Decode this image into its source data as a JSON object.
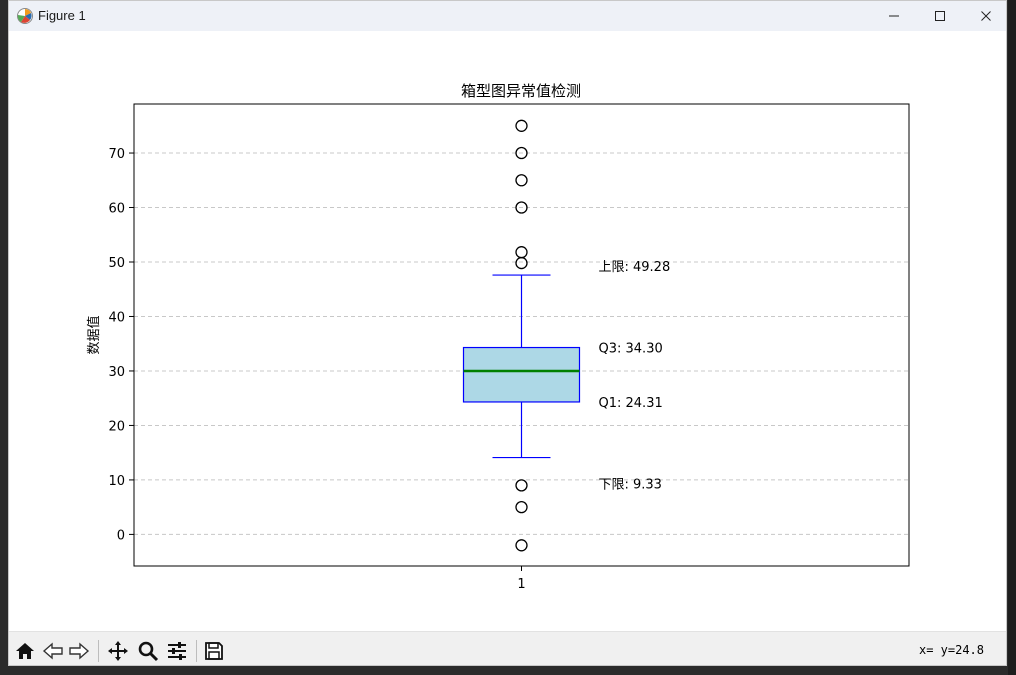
{
  "window": {
    "title": "Figure 1"
  },
  "toolbar": {
    "tools": [
      "home-icon",
      "back-arrow-icon",
      "forward-arrow-icon",
      "pan-icon",
      "zoom-icon",
      "configure-subplots-icon",
      "save-icon"
    ],
    "coords": "x= y=24.8"
  },
  "chart_data": {
    "type": "box",
    "title": "箱型图异常值检测",
    "xlabel": "",
    "ylabel": "数据值",
    "ylim": [
      -5.8,
      79
    ],
    "yticks": [
      0,
      10,
      20,
      30,
      40,
      50,
      60,
      70
    ],
    "categories": [
      "1"
    ],
    "grid": "y-dashed",
    "box": {
      "q1": 24.31,
      "median": 30.0,
      "q3": 34.3,
      "whisker_low": 14.1,
      "whisker_high": 47.6
    },
    "outliers": [
      75,
      70,
      65,
      60,
      51.8,
      49.8,
      9,
      5,
      -2
    ],
    "annotations": [
      {
        "text": "上限: 49.28",
        "y": 49.28
      },
      {
        "text": "Q3: 34.30",
        "y": 34.3
      },
      {
        "text": "Q1: 24.31",
        "y": 24.31
      },
      {
        "text": "下限: 9.33",
        "y": 9.33
      }
    ],
    "colors": {
      "box_fill": "#add8e6",
      "box_edge": "#0000ff",
      "median": "#008000",
      "grid": "#c8c8c8"
    }
  }
}
